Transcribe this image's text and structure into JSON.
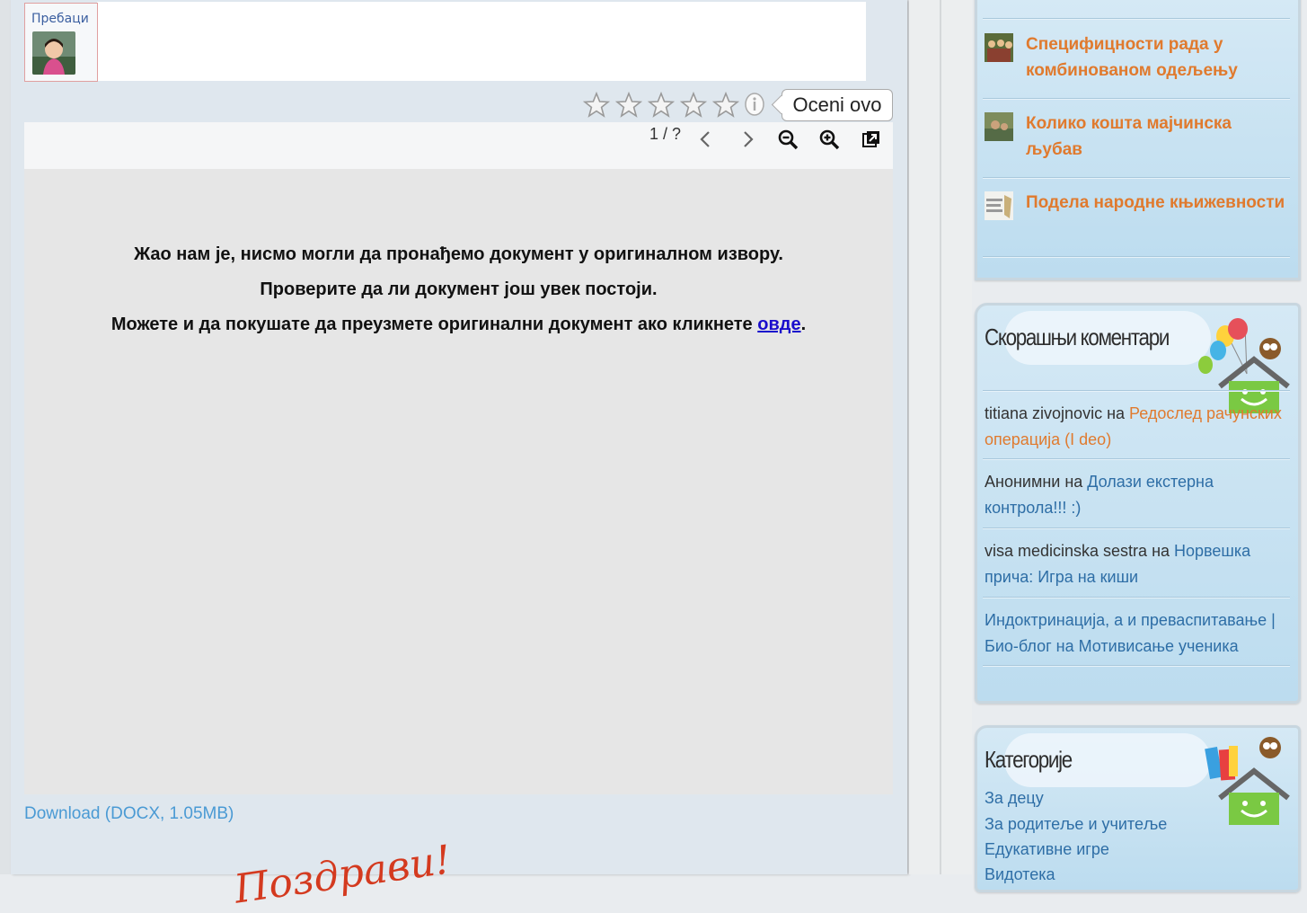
{
  "share": {
    "label": "Пребаци"
  },
  "rating": {
    "tooltip": "Oceni ovo",
    "stars": 0,
    "max": 5
  },
  "viewer": {
    "page_indicator": "1 / ?",
    "message_line1": "Жао нам је, нисмо могли да пронађемо документ у оригиналном извору.",
    "message_line2": "Проверите да ли документ још увек постоји.",
    "message_line3_prefix": "Можете и да покушате да преузмете оригинални документ ако кликнете ",
    "message_link": "овде",
    "message_line3_suffix": "."
  },
  "download": {
    "label": "Download (DOCX, 1.05MB)"
  },
  "footer_script": {
    "text": "Поздрави!"
  },
  "sidebar": {
    "popular_posts": [
      {
        "title": "Специфицности рада у комбинованом одељењу"
      },
      {
        "title": "Колико кошта мајчинска љубав"
      },
      {
        "title": "Подела народне књижевности"
      }
    ],
    "recent_comments": {
      "title": "Скорашњи коментари",
      "items": [
        {
          "author": "titiana zivojnovic",
          "sep": " на ",
          "post": "Редослед рачунских операција (I deo)",
          "style": "orange"
        },
        {
          "author": "Анонимни",
          "sep": " на ",
          "post": "Долази екстерна контрола!!! :)",
          "style": "blue"
        },
        {
          "author": "visa medicinska sestra",
          "sep": " на ",
          "post": "Норвешка прича: Игра на киши",
          "style": "blue"
        },
        {
          "author": "",
          "sep": "",
          "post": "Индоктринација, а и преваспитавање | Био-блог на Мотивисање ученика",
          "style": "blue"
        }
      ]
    },
    "categories": {
      "title": "Категорије",
      "items": [
        "За децу",
        "За родитеље и учитеље",
        "Едукативне игре",
        "Видотека"
      ]
    }
  },
  "colors": {
    "link_orange": "#e07a2e",
    "link_blue": "#2e6ea6",
    "download_blue": "#4a9ad4"
  }
}
